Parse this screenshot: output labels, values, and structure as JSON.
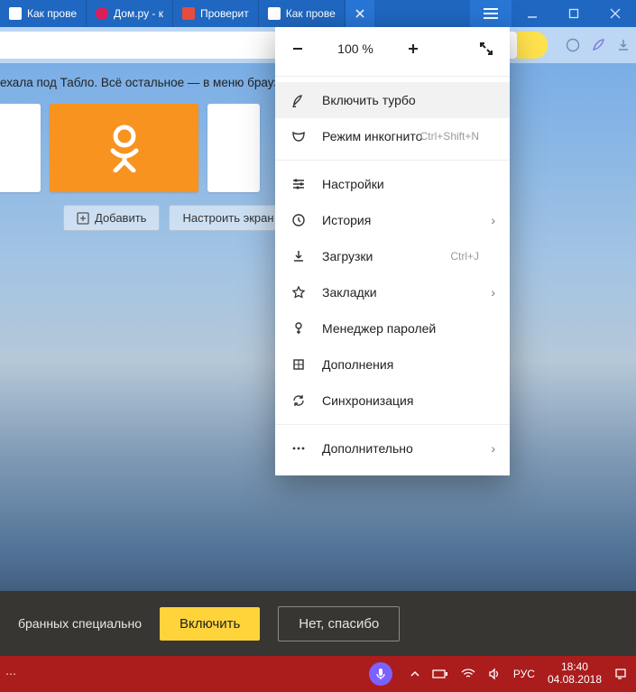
{
  "tabs": [
    {
      "label": "Как прове"
    },
    {
      "label": "Дом.ру - к"
    },
    {
      "label": "Проверит"
    },
    {
      "label": "Как прове"
    }
  ],
  "page": {
    "message": "ехала под Табло. Всё остальное — в меню браузер",
    "add_btn": "Добавить",
    "customize_btn": "Настроить экран"
  },
  "menu": {
    "zoom": "100 %",
    "turbo": "Включить турбо",
    "incognito": "Режим инкогнито",
    "incognito_hint": "Ctrl+Shift+N",
    "settings": "Настройки",
    "history": "История",
    "downloads": "Загрузки",
    "downloads_hint": "Ctrl+J",
    "bookmarks": "Закладки",
    "passwords": "Менеджер паролей",
    "addons": "Дополнения",
    "sync": "Синхронизация",
    "more": "Дополнительно"
  },
  "banner": {
    "text": "бранных специально",
    "enable": "Включить",
    "decline": "Нет, спасибо"
  },
  "tray": {
    "lang": "РУС",
    "time": "18:40",
    "date": "04.08.2018"
  }
}
